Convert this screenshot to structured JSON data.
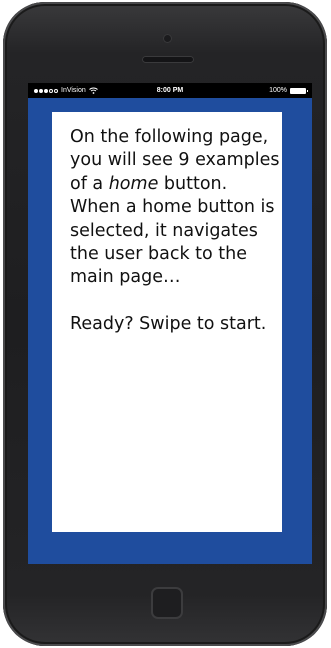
{
  "status_bar": {
    "carrier": "InVision",
    "time": "8:00 PM",
    "battery": "100%",
    "signal_dots_filled": 3,
    "signal_dots_total": 5
  },
  "card": {
    "intro": "On the following page, you will see 9 examples of a ",
    "emphasis": "home",
    "body": " button. When a home button is selected, it navigates the user back to the main page…\n\nReady? Swipe to start."
  },
  "colors": {
    "screen_background": "#1f4d9e",
    "card_background": "#ffffff",
    "device_body": "#1e1e20"
  }
}
